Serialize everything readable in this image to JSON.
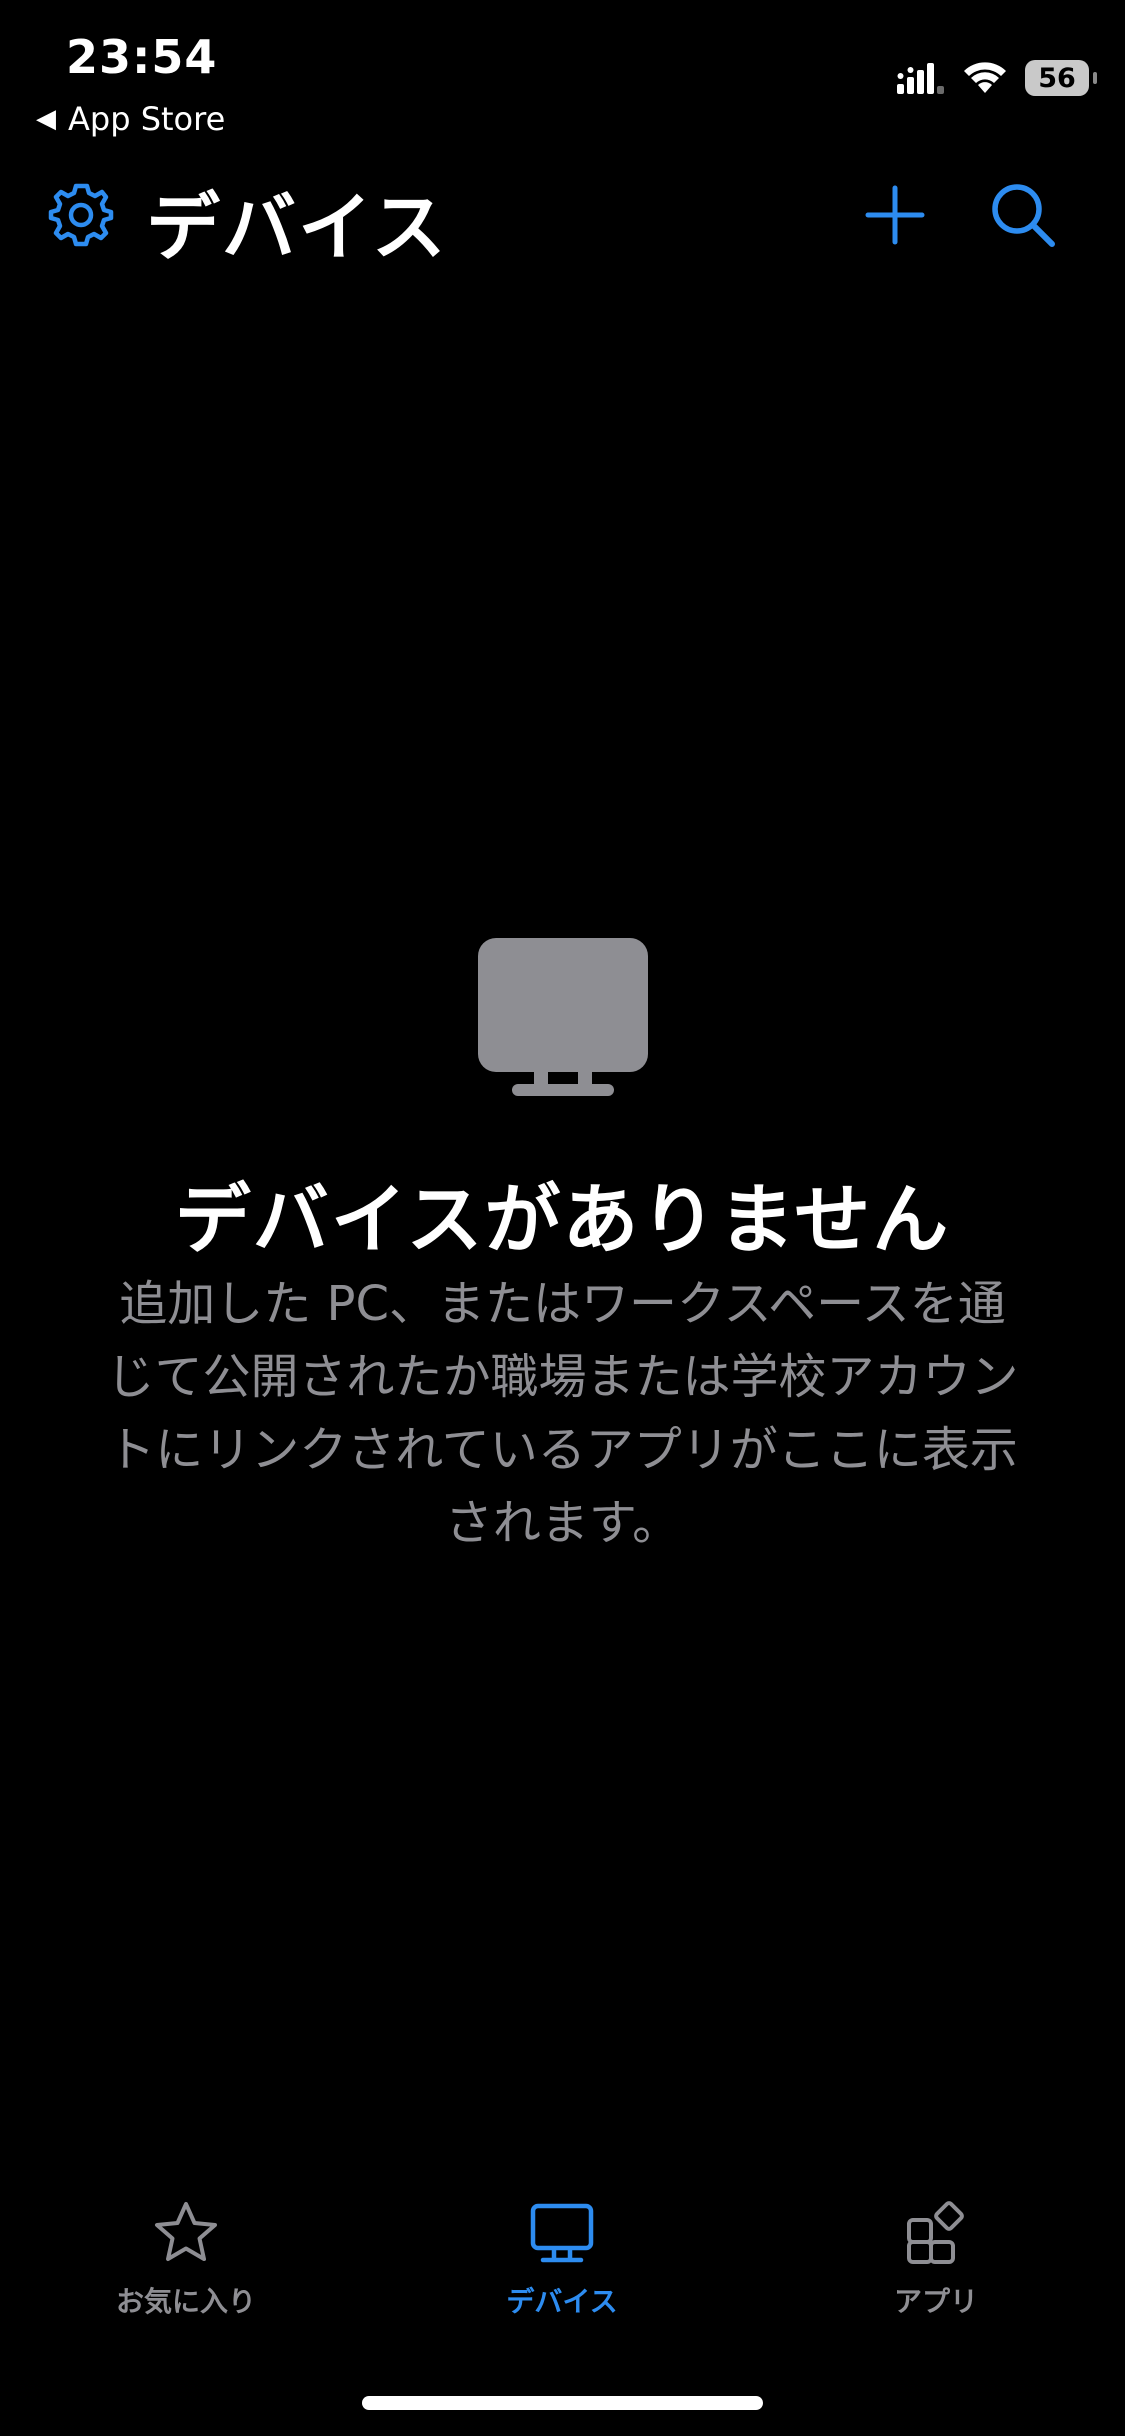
{
  "status_bar": {
    "time": "23:54",
    "back_label": "App Store",
    "battery": "56"
  },
  "header": {
    "title": "デバイス"
  },
  "empty_state": {
    "title": "デバイスがありません",
    "description": "追加した PC、またはワークスペースを通じて公開されたか職場または学校アカウントにリンクされているアプリがここに表示されます。"
  },
  "tabbar": {
    "tabs": [
      {
        "label": "お気に入り",
        "icon": "star-icon",
        "selected": false
      },
      {
        "label": "デバイス",
        "icon": "monitor-icon",
        "selected": true
      },
      {
        "label": "アプリ",
        "icon": "apps-icon",
        "selected": false
      }
    ]
  },
  "colors": {
    "background": "#000000",
    "accent": "#2d8cf0",
    "secondary_text": "#8e8e93",
    "icon_gray": "#8e8e93"
  }
}
